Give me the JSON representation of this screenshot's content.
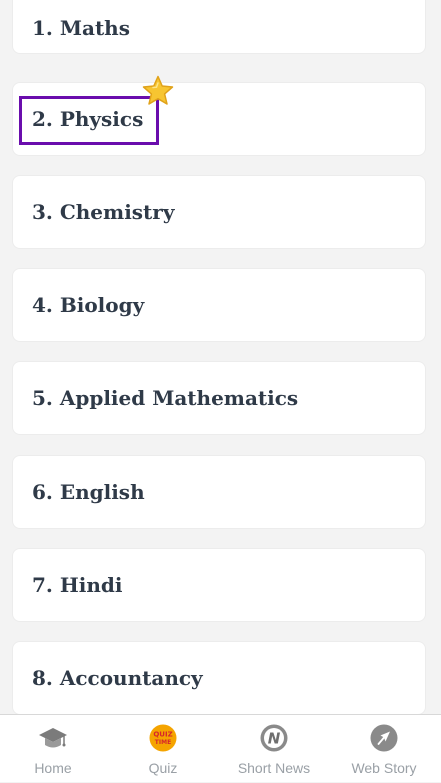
{
  "subjects": [
    {
      "label": "1. Maths"
    },
    {
      "label": "2. Physics"
    },
    {
      "label": "3. Chemistry"
    },
    {
      "label": "4. Biology"
    },
    {
      "label": "5. Applied Mathematics"
    },
    {
      "label": "6. English"
    },
    {
      "label": "7. Hindi"
    },
    {
      "label": "8. Accountancy"
    }
  ],
  "highlighted_item": "2. Physics",
  "bottom_nav": [
    {
      "label": "Home",
      "icon": "graduation-cap-icon"
    },
    {
      "label": "Quiz",
      "icon": "quiz-time-icon",
      "icon_text": "QUIZ TIME"
    },
    {
      "label": "Short News",
      "icon": "news-n-icon",
      "icon_text": "N"
    },
    {
      "label": "Web Story",
      "icon": "navigation-arrow-icon"
    }
  ],
  "colors": {
    "background": "#f3f3f3",
    "card": "#ffffff",
    "text": "#2f3a48",
    "highlight_border": "#6a0dad",
    "nav_text": "#9aa0a6",
    "icon_gray": "#8a8a8a",
    "quiz_orange": "#f5a400",
    "quiz_text": "#d6262b",
    "star_yellow": "#f7c531"
  }
}
